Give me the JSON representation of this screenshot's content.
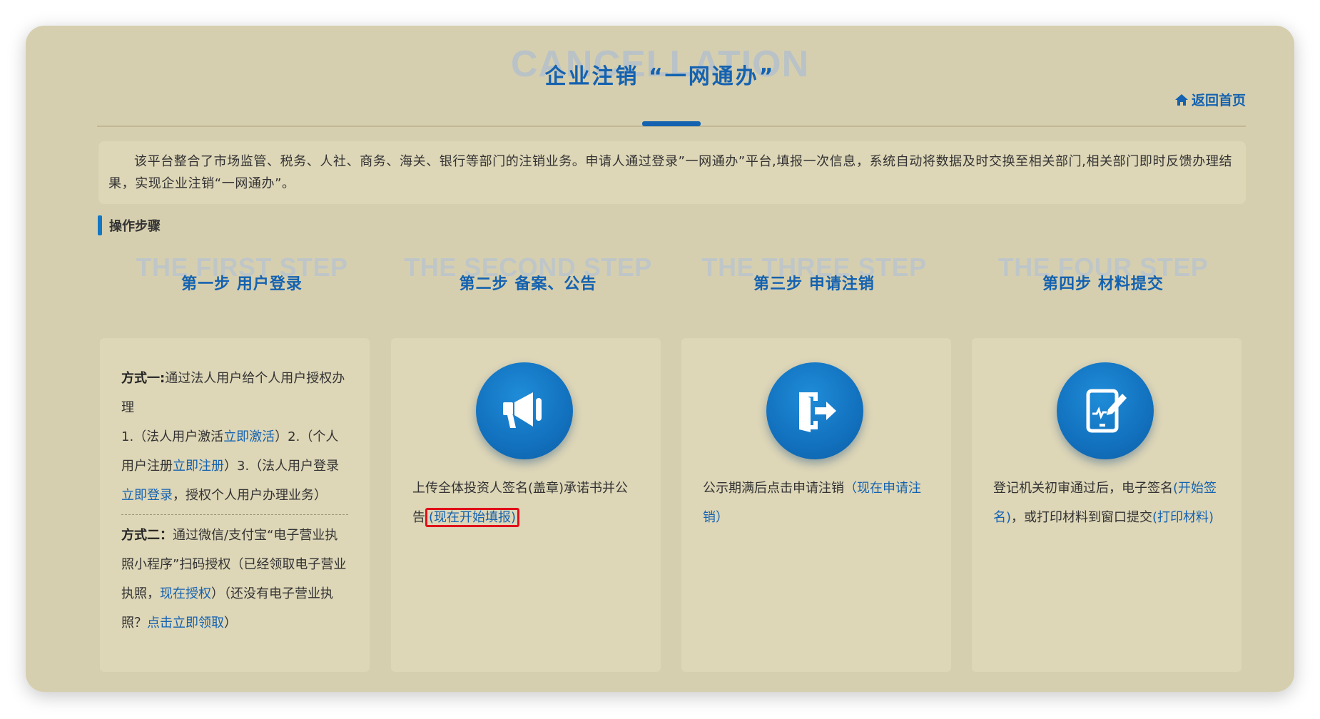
{
  "header": {
    "bg_word": "CANCELLATION",
    "title": "企业注销 “一网通办”",
    "home_link": "返回首页"
  },
  "intro": {
    "text": "该平台整合了市场监管、税务、人社、商务、海关、银行等部门的注销业务。申请人通过登录”一网通办”平台,填报一次信息，系统自动将数据及时交换至相关部门,相关部门即时反馈办理结果，实现企业注销“一网通办”。"
  },
  "section": {
    "title": "操作步骤"
  },
  "steps": [
    {
      "bg": "THE FIRST STEP",
      "title": "第一步 用户登录"
    },
    {
      "bg": "THE SECOND STEP",
      "title": "第二步 备案、公告"
    },
    {
      "bg": "THE THREE STEP",
      "title": "第三步 申请注销"
    },
    {
      "bg": "THE FOUR STEP",
      "title": "第四步 材料提交"
    }
  ],
  "card1": {
    "m1_label": "方式一:",
    "m1_text": "通过法人用户给个人用户授权办理",
    "l1_a": "1.（法人用户激活",
    "l1_link": "立即激活",
    "l1_b": "）2.（个人用户注册",
    "l1_link2": "立即注册",
    "l1_c": "）3.（法人用户登录",
    "l1_link3": "立即登录",
    "l1_d": "，授权个人用户办理业务）",
    "m2_label": "方式二：",
    "m2_a": "通过微信/支付宝“电子营业执照小程序”扫码授权（已经领取电子营业执照，",
    "m2_link": "现在授权",
    "m2_b": "）（还没有电子营业执照？",
    "m2_link2": "点击立即领取",
    "m2_c": "）"
  },
  "card2": {
    "icon": "megaphone-icon",
    "text": "上传全体投资人签名(盖章)承诺书并公告",
    "link": "(现在开始填报)"
  },
  "card3": {
    "icon": "exit-door-icon",
    "text": "公示期满后点击申请注销",
    "link": "（现在申请注销）"
  },
  "card4": {
    "icon": "tablet-sign-icon",
    "text_a": "登记机关初审通过后，电子签名",
    "link1": "(开始签名)",
    "text_b": "，或打印材料到窗口提交",
    "link2": "(打印材料)"
  },
  "colors": {
    "accent": "#1462b0",
    "panel": "#d6cfaf",
    "highlight": "#e0101a"
  }
}
